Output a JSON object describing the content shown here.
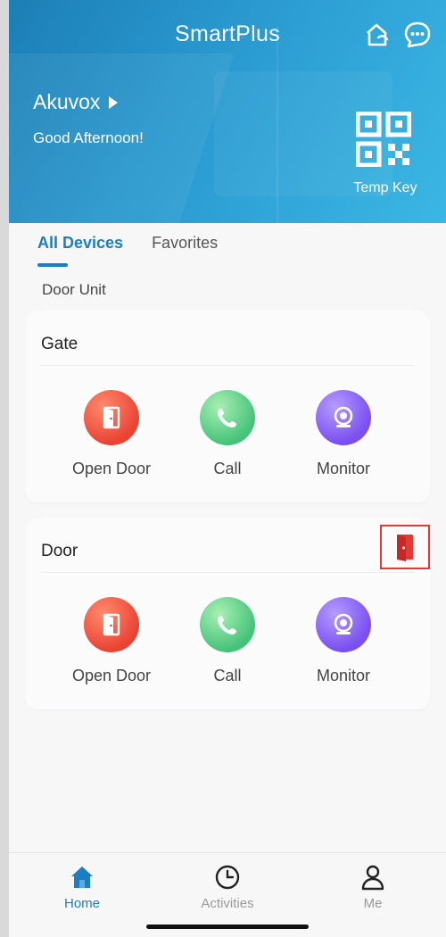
{
  "header": {
    "app_title": "SmartPlus",
    "site_name": "Akuvox",
    "greeting": "Good Afternoon!",
    "temp_key_label": "Temp Key",
    "icons": [
      "home-switch-icon",
      "message-icon",
      "qr-code-icon",
      "play-arrow-icon"
    ]
  },
  "tabs": [
    {
      "label": "All Devices",
      "active": true
    },
    {
      "label": "Favorites",
      "active": false
    }
  ],
  "section_label": "Door Unit",
  "devices": [
    {
      "name": "Gate",
      "actions": [
        {
          "label": "Open Door",
          "icon": "door-open-icon"
        },
        {
          "label": "Call",
          "icon": "phone-icon"
        },
        {
          "label": "Monitor",
          "icon": "camera-icon"
        }
      ]
    },
    {
      "name": "Door",
      "quick_icon": "door-open-icon",
      "actions": [
        {
          "label": "Open Door",
          "icon": "door-open-icon"
        },
        {
          "label": "Call",
          "icon": "phone-icon"
        },
        {
          "label": "Monitor",
          "icon": "camera-icon"
        }
      ]
    }
  ],
  "bottom_nav": [
    {
      "label": "Home",
      "icon": "home-icon",
      "active": true
    },
    {
      "label": "Activities",
      "icon": "clock-icon",
      "active": false
    },
    {
      "label": "Me",
      "icon": "person-icon",
      "active": false
    }
  ],
  "colors": {
    "accent": "#1a7ec4",
    "open_door": "#ea4333",
    "call": "#46c37a",
    "monitor": "#7a4ff0",
    "highlight_box": "#e53935"
  }
}
